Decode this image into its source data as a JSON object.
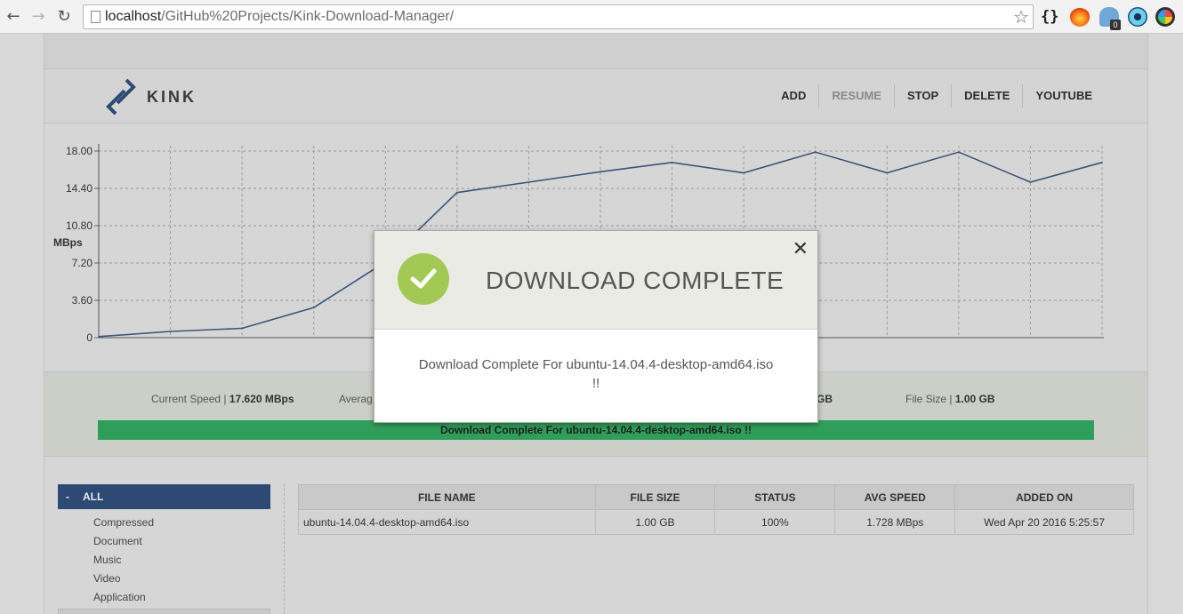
{
  "browser": {
    "url_host": "localhost",
    "url_path": "/GitHub%20Projects/Kink-Download-Manager/"
  },
  "app": {
    "logo_text": "KINK",
    "menu": [
      {
        "label": "ADD",
        "enabled": true
      },
      {
        "label": "RESUME",
        "enabled": false
      },
      {
        "label": "STOP",
        "enabled": true
      },
      {
        "label": "DELETE",
        "enabled": true
      },
      {
        "label": "YOUTUBE",
        "enabled": true
      }
    ],
    "accent_color": "#2c4a73",
    "progress_color": "#2e9f5a"
  },
  "chart_data": {
    "type": "line",
    "ylabel": "MBps",
    "ylim": [
      0,
      18
    ],
    "yticks": [
      "0",
      "3.60",
      "7.20",
      "10.80",
      "14.40",
      "18.00"
    ],
    "x": [
      0,
      1,
      2,
      3,
      4,
      5,
      6,
      7,
      8,
      9,
      10,
      11,
      12,
      13,
      14
    ],
    "values": [
      0.1,
      0.6,
      0.9,
      2.9,
      7.3,
      14.0,
      15.0,
      16.0,
      16.9,
      15.9,
      17.9,
      15.9,
      17.9,
      15.0,
      16.9
    ],
    "grid": true,
    "line_color": "#3c557a"
  },
  "stats": {
    "current_speed_label": "Current Speed | ",
    "current_speed_value": "17.620 MBps",
    "average_partial": "Averag",
    "downloaded_partial": "GB",
    "file_size_label": "File Size | ",
    "file_size_value": "1.00 GB",
    "progress_percent": 100,
    "progress_text": "Download Complete For ubuntu-14.04.4-desktop-amd64.iso !!"
  },
  "sidebar": {
    "header": "ALL",
    "header_prefix": "-",
    "items": [
      "Compressed",
      "Document",
      "Music",
      "Video",
      "Application"
    ]
  },
  "table": {
    "headers": [
      "FILE NAME",
      "FILE SIZE",
      "STATUS",
      "AVG SPEED",
      "ADDED ON"
    ],
    "rows": [
      [
        "ubuntu-14.04.4-desktop-amd64.iso",
        "1.00 GB",
        "100%",
        "1.728 MBps",
        "Wed Apr 20 2016 5:25:57"
      ]
    ]
  },
  "modal": {
    "title": "DOWNLOAD COMPLETE",
    "close_glyph": "✕",
    "body_line1": "Download Complete For ubuntu-14.04.4-desktop-amd64.iso",
    "body_line2": "!!",
    "success_color": "#a3c955"
  }
}
